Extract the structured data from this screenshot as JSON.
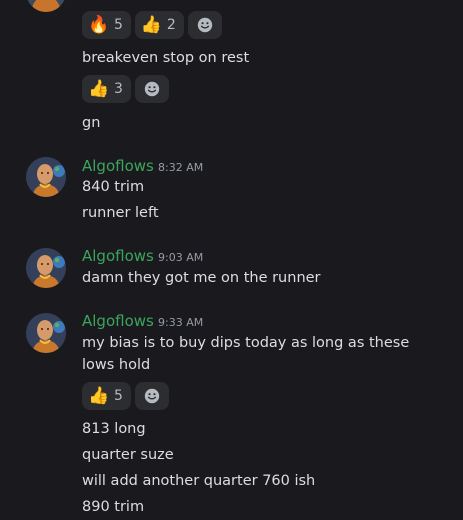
{
  "messages_top": {
    "reactions_1": [
      {
        "emoji": "🔥",
        "count": "5"
      },
      {
        "emoji": "👍",
        "count": "2"
      }
    ],
    "line_1": "breakeven stop on rest",
    "reactions_2": [
      {
        "emoji": "👍",
        "count": "3"
      }
    ],
    "line_2": "gn"
  },
  "groups": [
    {
      "author": "Algoflows",
      "time": "8:32 AM",
      "lines": [
        "840 trim",
        "runner left"
      ]
    },
    {
      "author": "Algoflows",
      "time": "9:03 AM",
      "lines": [
        "damn they got me on the runner"
      ]
    },
    {
      "author": "Algoflows",
      "time": "9:33 AM",
      "lines": [
        "my bias is to buy dips today as long as these lows hold"
      ],
      "reactions": [
        {
          "emoji": "👍",
          "count": "5"
        }
      ],
      "lines_after": [
        "813 long",
        "quarter suze",
        "will add another quarter 760 ish",
        "890 trim"
      ]
    }
  ],
  "colors": {
    "background": "#1a1a1e",
    "username": "#3ba55d",
    "timestamp": "#949ba4",
    "reaction_bg": "#2b2d31"
  },
  "icons": {
    "avatar": "bald-monk-avatar-icon",
    "add_reaction": "smiley-add-reaction-icon"
  }
}
